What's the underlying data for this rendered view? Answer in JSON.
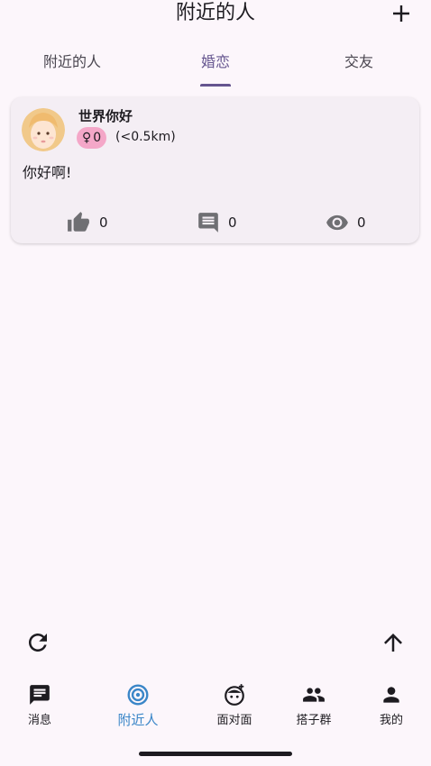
{
  "header": {
    "title": "附近的人",
    "add_icon": "plus-icon"
  },
  "tabs": [
    {
      "label": "附近的人",
      "selected": false
    },
    {
      "label": "婚恋",
      "selected": true
    },
    {
      "label": "交友",
      "selected": false
    }
  ],
  "post": {
    "username": "世界你好",
    "gender_symbol": "♀",
    "age": "0",
    "distance": "(<0.5km)",
    "content": "你好啊!",
    "likes": "0",
    "comments": "0",
    "views": "0"
  },
  "actions": {
    "refresh_icon": "refresh-icon",
    "scroll_top_icon": "arrow-up-icon"
  },
  "bottom_nav": [
    {
      "label": "消息",
      "icon": "chat-icon"
    },
    {
      "label": "附近人",
      "icon": "nearby-icon",
      "active": true
    },
    {
      "label": "面对面",
      "icon": "face-icon"
    },
    {
      "label": "搭子群",
      "icon": "group-icon"
    },
    {
      "label": "我的",
      "icon": "person-icon"
    }
  ],
  "colors": {
    "accent": "#65558f",
    "nav_active": "#3a86c8",
    "badge": "#f4a7c8",
    "background": "#fcf6fb"
  }
}
